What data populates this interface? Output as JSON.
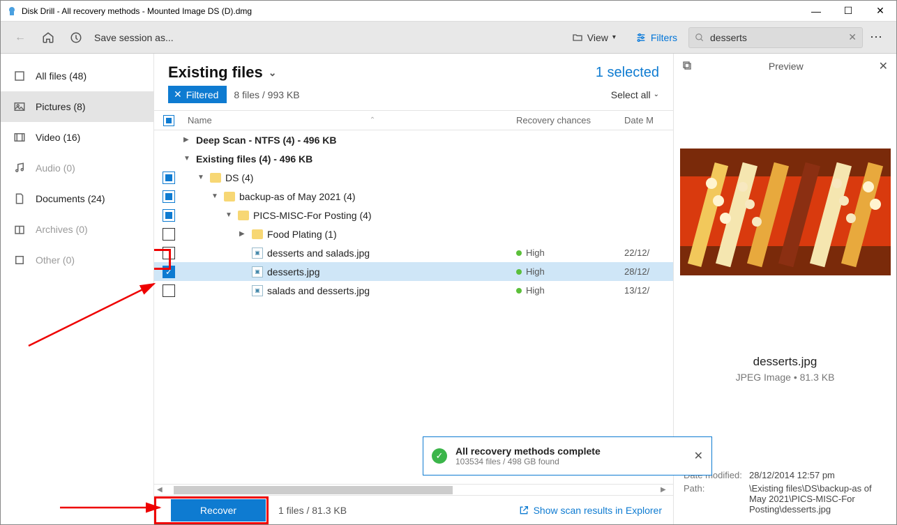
{
  "window": {
    "title": "Disk Drill - All recovery methods - Mounted Image DS (D).dmg"
  },
  "toolbar": {
    "save_session": "Save session as...",
    "view": "View",
    "filters": "Filters",
    "search_value": "desserts"
  },
  "sidebar": {
    "items": [
      {
        "label": "All files (48)",
        "muted": false
      },
      {
        "label": "Pictures (8)",
        "muted": false,
        "active": true
      },
      {
        "label": "Video (16)",
        "muted": false
      },
      {
        "label": "Audio (0)",
        "muted": true
      },
      {
        "label": "Documents (24)",
        "muted": false
      },
      {
        "label": "Archives (0)",
        "muted": true
      },
      {
        "label": "Other (0)",
        "muted": true
      }
    ]
  },
  "content": {
    "title": "Existing files",
    "selected_label": "1 selected",
    "filtered_chip": "Filtered",
    "sub_count": "8 files / 993 KB",
    "select_all": "Select all",
    "columns": {
      "name": "Name",
      "recovery": "Recovery chances",
      "date": "Date M"
    }
  },
  "rows": [
    {
      "type": "group",
      "expand": "▶",
      "name": "Deep Scan - NTFS (4) - 496 KB",
      "bold": true,
      "chk": "none"
    },
    {
      "type": "group",
      "expand": "▼",
      "name": "Existing files (4) - 496 KB",
      "bold": true,
      "chk": "none"
    },
    {
      "type": "folder",
      "indent": 1,
      "expand": "▼",
      "name": "DS (4)",
      "chk": "partial"
    },
    {
      "type": "folder",
      "indent": 2,
      "expand": "▼",
      "name": "backup-as of May 2021 (4)",
      "chk": "partial"
    },
    {
      "type": "folder",
      "indent": 3,
      "expand": "▼",
      "name": "PICS-MISC-For Posting (4)",
      "chk": "partial"
    },
    {
      "type": "folder",
      "indent": 4,
      "expand": "▶",
      "name": "Food Plating (1)",
      "chk": "empty"
    },
    {
      "type": "file",
      "indent": 4,
      "name": "desserts and salads.jpg",
      "chk": "empty",
      "rec": "High",
      "date": "22/12/"
    },
    {
      "type": "file",
      "indent": 4,
      "name": "desserts.jpg",
      "chk": "checked",
      "rec": "High",
      "date": "28/12/",
      "selected": true
    },
    {
      "type": "file",
      "indent": 4,
      "name": "salads and desserts.jpg",
      "chk": "empty",
      "rec": "High",
      "date": "13/12/"
    }
  ],
  "toast": {
    "title": "All recovery methods complete",
    "sub": "103534 files / 498 GB found"
  },
  "footer": {
    "recover": "Recover",
    "count": "1 files / 81.3 KB",
    "explorer": "Show scan results in Explorer"
  },
  "preview": {
    "header": "Preview",
    "filename": "desserts.jpg",
    "filetype": "JPEG Image • 81.3 KB",
    "date_label": "Date modified:",
    "date_value": "28/12/2014 12:57 pm",
    "path_label": "Path:",
    "path_value": "\\Existing files\\DS\\backup-as of May 2021\\PICS-MISC-For Posting\\desserts.jpg"
  }
}
